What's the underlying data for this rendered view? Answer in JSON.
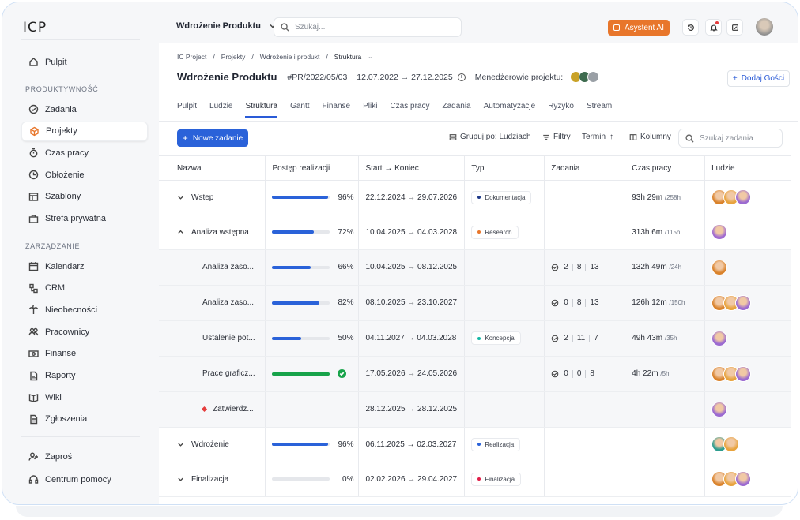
{
  "logo": "ICP",
  "sidebar": {
    "top": [
      {
        "label": "Pulpit",
        "icon": "home-icon"
      }
    ],
    "section1": "PRODUKTYWNOŚĆ",
    "productivity": [
      {
        "label": "Zadania",
        "icon": "check-circle-icon"
      },
      {
        "label": "Projekty",
        "icon": "cube-icon",
        "active": true
      },
      {
        "label": "Czas pracy",
        "icon": "stopwatch-icon"
      },
      {
        "label": "Obłożenie",
        "icon": "clock-icon"
      },
      {
        "label": "Szablony",
        "icon": "template-icon"
      },
      {
        "label": "Strefa prywatna",
        "icon": "briefcase-icon"
      }
    ],
    "section2": "ZARZĄDZANIE",
    "management": [
      {
        "label": "Kalendarz",
        "icon": "calendar-icon"
      },
      {
        "label": "CRM",
        "icon": "crm-icon"
      },
      {
        "label": "Nieobecności",
        "icon": "palm-icon"
      },
      {
        "label": "Pracownicy",
        "icon": "users-icon"
      },
      {
        "label": "Finanse",
        "icon": "money-icon"
      },
      {
        "label": "Raporty",
        "icon": "report-icon"
      },
      {
        "label": "Wiki",
        "icon": "book-icon"
      },
      {
        "label": "Zgłoszenia",
        "icon": "ticket-icon"
      }
    ],
    "bottom": [
      {
        "label": "Zaproś",
        "icon": "user-plus-icon"
      },
      {
        "label": "Centrum pomocy",
        "icon": "headset-icon"
      }
    ]
  },
  "topbar": {
    "project": "Wdrożenie Produktu",
    "search_placeholder": "Szukaj...",
    "ai_button": "Asystent AI"
  },
  "breadcrumbs": [
    "IC Project",
    "Projekty",
    "Wdrożenie i produkt",
    "Struktura"
  ],
  "header": {
    "title": "Wdrożenie Produktu",
    "code": "#PR/2022/05/03",
    "dates": "12.07.2022 → 27.12.2025",
    "managers_label": "Menedżerowie projektu:",
    "add_guests": "Dodaj Gości"
  },
  "tabs": [
    "Pulpit",
    "Ludzie",
    "Struktura",
    "Gantt",
    "Finanse",
    "Pliki",
    "Czas pracy",
    "Zadania",
    "Automatyzacje",
    "Ryzyko",
    "Stream"
  ],
  "active_tab": "Struktura",
  "toolbar": {
    "new_task": "Nowe zadanie",
    "group_by": "Grupuj po: Ludziach",
    "filters": "Filtry",
    "deadline": "Termin",
    "columns": "Kolumny",
    "search_placeholder": "Szukaj zadania"
  },
  "columns": [
    "Nazwa",
    "Postęp realizacji",
    "Start → Koniec",
    "Typ",
    "Zadania",
    "Czas pracy",
    "Ludzie"
  ],
  "rows": [
    {
      "name": "Wstep",
      "level": 0,
      "chevron": "down",
      "progress": 96,
      "dates": "22.12.2024 → 29.07.2026",
      "type": "Dokumentacja",
      "type_color": "#1f3a8a",
      "tasks": null,
      "time": "93h 29m",
      "time_plan": "/258h",
      "people": [
        "#d9822b",
        "#e8a33d",
        "#9b6ad1"
      ]
    },
    {
      "name": "Analiza wstępna",
      "level": 0,
      "chevron": "up",
      "progress": 72,
      "dates": "10.04.2025 → 04.03.2028",
      "type": "Research",
      "type_color": "#e8762b",
      "tasks": null,
      "time": "313h 6m",
      "time_plan": "/115h",
      "people": [
        "#a06ad1"
      ]
    },
    {
      "name": "Analiza zaso...",
      "level": 1,
      "progress": 66,
      "dates": "10.04.2025 → 08.12.2025",
      "type": "",
      "tasks": [
        "2",
        "8",
        "13"
      ],
      "time": "132h 49m",
      "time_plan": "/24h",
      "people": [
        "#d9822b"
      ]
    },
    {
      "name": "Analiza zaso...",
      "level": 1,
      "progress": 82,
      "dates": "08.10.2025 → 23.10.2027",
      "type": "",
      "tasks": [
        "0",
        "8",
        "13"
      ],
      "time": "126h 12m",
      "time_plan": "/150h",
      "people": [
        "#d9822b",
        "#e8a33d",
        "#9b6ad1"
      ]
    },
    {
      "name": "Ustalenie pot...",
      "level": 1,
      "progress": 50,
      "dates": "04.11.2027 → 04.03.2028",
      "type": "Koncepcja",
      "type_color": "#14b8a6",
      "tasks": [
        "2",
        "11",
        "7"
      ],
      "time": "49h 43m",
      "time_plan": "/35h",
      "people": [
        "#9b6ad1"
      ]
    },
    {
      "name": "Prace graficz...",
      "level": 1,
      "progress": 100,
      "done": true,
      "dates": "17.05.2026 → 24.05.2026",
      "type": "",
      "tasks": [
        "0",
        "0",
        "8"
      ],
      "time": "4h 22m",
      "time_plan": "/5h",
      "people": [
        "#d9822b",
        "#e8a33d",
        "#9b6ad1"
      ]
    },
    {
      "name": "Zatwierdz...",
      "level": 1,
      "milestone": true,
      "progress": null,
      "dates": "28.12.2025 → 28.12.2025",
      "type": "",
      "tasks": null,
      "time": "",
      "time_plan": "",
      "people": [
        "#9b6ad1"
      ]
    },
    {
      "name": "Wdrożenie",
      "level": 0,
      "chevron": "down",
      "progress": 96,
      "dates": "06.11.2025 → 02.03.2027",
      "type": "Realizacja",
      "type_color": "#2a62d9",
      "tasks": null,
      "time": "",
      "time_plan": "",
      "people": [
        "#2d9d8f",
        "#e8a33d"
      ]
    },
    {
      "name": "Finalizacja",
      "level": 0,
      "chevron": "down",
      "progress": 0,
      "dates": "02.02.2026 → 29.04.2027",
      "type": "Finalizacja",
      "type_color": "#e11d48",
      "tasks": null,
      "time": "",
      "time_plan": "",
      "people": [
        "#d9822b",
        "#e8a33d",
        "#9b6ad1"
      ]
    }
  ]
}
